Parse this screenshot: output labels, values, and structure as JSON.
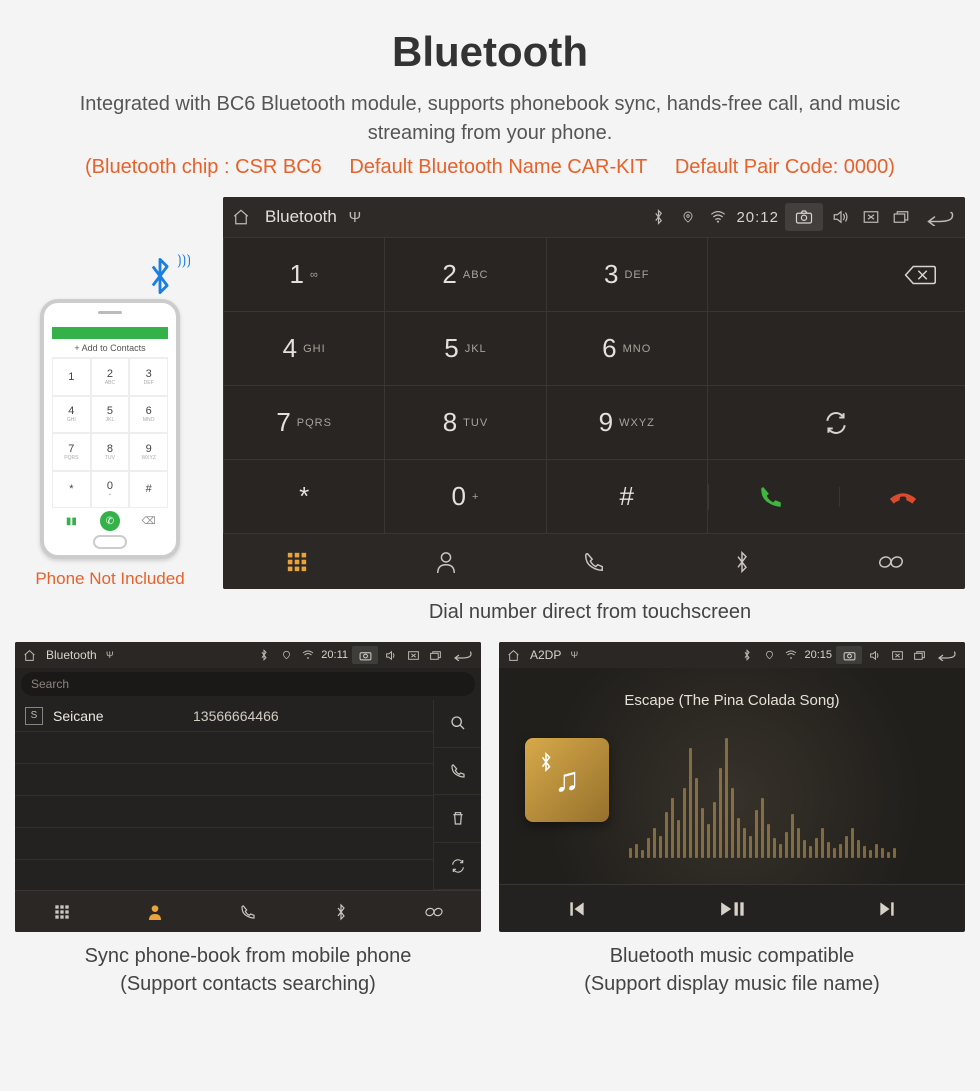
{
  "header": {
    "title": "Bluetooth",
    "subtitle": "Integrated with BC6 Bluetooth module, supports phonebook sync, hands-free call, and music streaming from your phone.",
    "spec_chip": "(Bluetooth chip : CSR BC6",
    "spec_name": "Default Bluetooth Name CAR-KIT",
    "spec_pair": "Default Pair Code: 0000)"
  },
  "phone": {
    "add_label": "Add to Contacts",
    "caption": "Phone Not Included",
    "keys": [
      "1",
      "2",
      "3",
      "4",
      "5",
      "6",
      "7",
      "8",
      "9",
      "*",
      "0",
      "#"
    ],
    "subs": [
      "",
      "ABC",
      "DEF",
      "GHI",
      "JKL",
      "MNO",
      "PQRS",
      "TUV",
      "WXYZ",
      "",
      "+",
      ""
    ]
  },
  "main": {
    "statusbar": {
      "title": "Bluetooth",
      "clock": "20:12"
    },
    "keys": [
      {
        "n": "1",
        "l": "∞"
      },
      {
        "n": "2",
        "l": "ABC"
      },
      {
        "n": "3",
        "l": "DEF"
      },
      {
        "n": "4",
        "l": "GHI"
      },
      {
        "n": "5",
        "l": "JKL"
      },
      {
        "n": "6",
        "l": "MNO"
      },
      {
        "n": "7",
        "l": "PQRS"
      },
      {
        "n": "8",
        "l": "TUV"
      },
      {
        "n": "9",
        "l": "WXYZ"
      },
      {
        "n": "*",
        "l": ""
      },
      {
        "n": "0",
        "l": "+"
      },
      {
        "n": "#",
        "l": ""
      }
    ],
    "caption": "Dial number direct from touchscreen"
  },
  "contacts": {
    "statusbar": {
      "title": "Bluetooth",
      "clock": "20:11"
    },
    "search_placeholder": "Search",
    "rows": [
      {
        "badge": "S",
        "name": "Seicane",
        "number": "13566664466"
      }
    ],
    "caption_l1": "Sync phone-book from mobile phone",
    "caption_l2": "(Support contacts searching)"
  },
  "music": {
    "statusbar": {
      "title": "A2DP",
      "clock": "20:15"
    },
    "song": "Escape (The Pina Colada Song)",
    "caption_l1": "Bluetooth music compatible",
    "caption_l2": "(Support display music file name)"
  }
}
